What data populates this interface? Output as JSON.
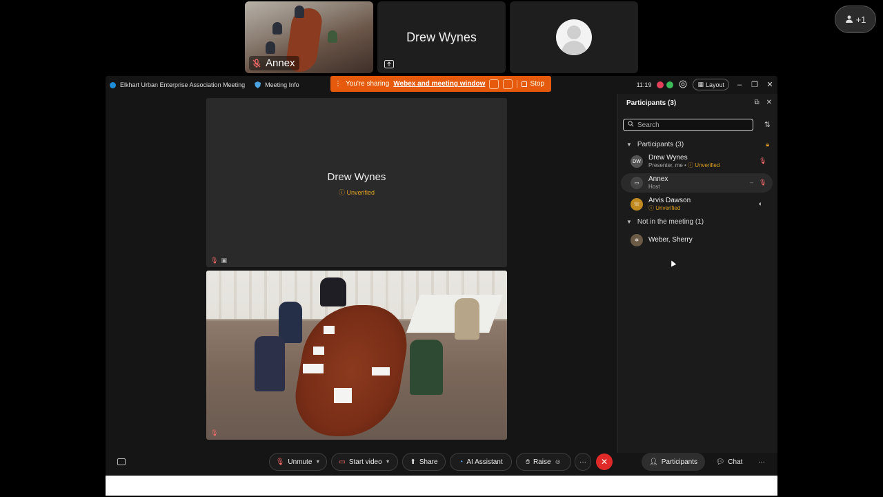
{
  "thumbnails": {
    "room_name": "Annex",
    "presenter_name": "Drew Wynes"
  },
  "add_participant": {
    "label": "+1"
  },
  "titlebar": {
    "meeting_name": "Elkhart Urban Enterprise Association Meeting",
    "meeting_info": "Meeting Info",
    "share_prefix": "You're sharing",
    "share_target": "Webex and meeting window",
    "stop_label": "Stop",
    "time": "11:19",
    "layout_label": "Layout"
  },
  "stage": {
    "presenter_name": "Drew Wynes",
    "presenter_status": "Unverified"
  },
  "panel": {
    "title": "Participants (3)",
    "search_placeholder": "Search",
    "section_in": "Participants (3)",
    "section_out": "Not in the meeting (1)",
    "participants": [
      {
        "initials": "DW",
        "name": "Drew Wynes",
        "role": "Presenter, me",
        "status": "Unverified"
      },
      {
        "initials": "",
        "name": "Annex",
        "role": "Host",
        "status": ""
      },
      {
        "initials": "",
        "name": "Arvis Dawson",
        "role": "",
        "status": "Unverified"
      }
    ],
    "absent": [
      {
        "name": "Weber, Sherry"
      }
    ]
  },
  "controls": {
    "unmute": "Unmute",
    "start_video": "Start video",
    "share": "Share",
    "ai_assistant": "AI Assistant",
    "raise": "Raise",
    "more": "···",
    "participants": "Participants",
    "chat": "Chat",
    "overflow": "···"
  },
  "colors": {
    "share_banner": "#e55a0c",
    "end_call": "#e02a2a",
    "unverified": "#e0a020"
  }
}
